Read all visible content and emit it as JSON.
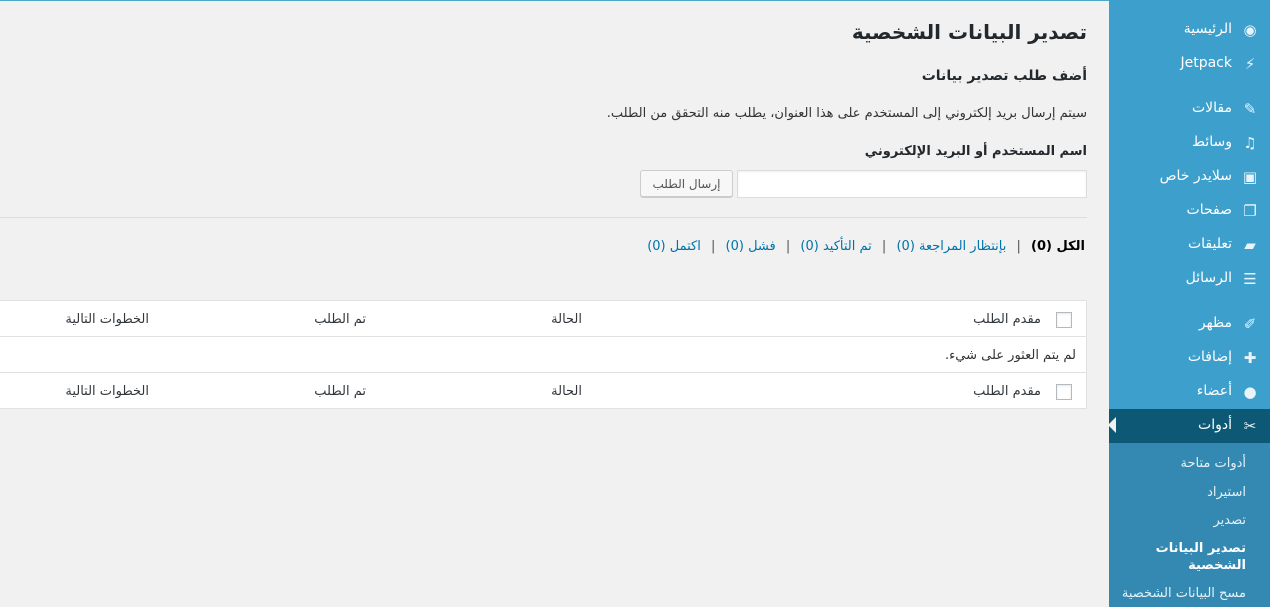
{
  "sidebar": {
    "items": [
      {
        "label": "الرئيسية",
        "icon": "dashboard-icon",
        "glyph": "◉"
      },
      {
        "label": "Jetpack",
        "icon": "jetpack-icon",
        "glyph": "⚡"
      },
      {
        "label": "مقالات",
        "icon": "pin-icon",
        "glyph": "✎"
      },
      {
        "label": "وسائط",
        "icon": "media-icon",
        "glyph": "♫"
      },
      {
        "label": "سلايدر خاص",
        "icon": "slider-icon",
        "glyph": "▣"
      },
      {
        "label": "صفحات",
        "icon": "pages-icon",
        "glyph": "❐"
      },
      {
        "label": "تعليقات",
        "icon": "comments-icon",
        "glyph": "▰"
      },
      {
        "label": "الرسائل",
        "icon": "messages-icon",
        "glyph": "☰"
      },
      {
        "label": "مظهر",
        "icon": "appearance-icon",
        "glyph": "✐"
      },
      {
        "label": "إضافات",
        "icon": "plugins-icon",
        "glyph": "✚"
      },
      {
        "label": "أعضاء",
        "icon": "users-icon",
        "glyph": "●"
      },
      {
        "label": "أدوات",
        "icon": "tools-icon",
        "glyph": "✂"
      }
    ],
    "submenu": [
      {
        "label": "أدوات متاحة"
      },
      {
        "label": "استيراد"
      },
      {
        "label": "تصدير"
      },
      {
        "label": "تصدير البيانات الشخصية"
      },
      {
        "label": "مسح البيانات الشخصية"
      }
    ]
  },
  "main": {
    "page_title": "تصدير البيانات الشخصية",
    "section_title": "أضف طلب تصدير بيانات",
    "description": "سيتم إرسال بريد إلكتروني إلى المستخدم على هذا العنوان، يطلب منه التحقق من الطلب.",
    "field_label": "اسم المستخدم أو البريد الإلكتروني",
    "input_value": "",
    "submit_label": "إرسال الطلب",
    "filters": {
      "all": "الكل",
      "all_count": "(0)",
      "pending": "بإنتظار المراجعة (0)",
      "confirmed": "تم التأكيد (0)",
      "failed": "فشل (0)",
      "completed": "اكتمل (0)"
    },
    "table": {
      "columns": [
        "مقدم الطلب",
        "الحالة",
        "تم الطلب",
        "الخطوات التالية"
      ],
      "empty_message": "لم يتم العثور على شيء."
    }
  }
}
